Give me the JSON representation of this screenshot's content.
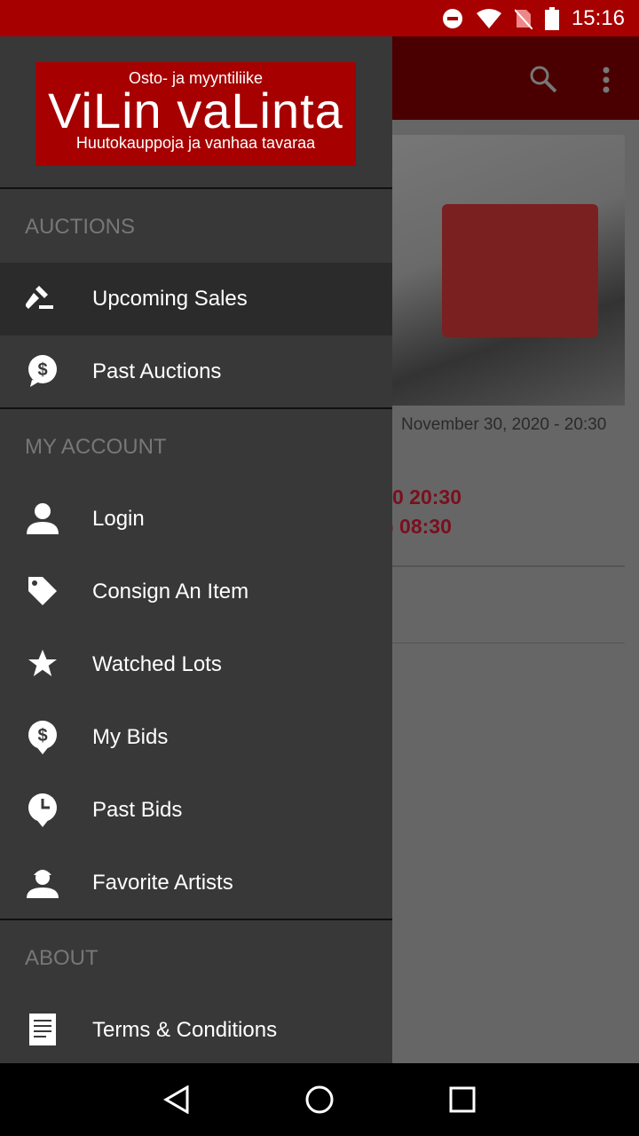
{
  "status_bar": {
    "time": "15:16"
  },
  "logo": {
    "line1": "Osto- ja myyntiliike",
    "line2": "ViLin vaLinta",
    "line3": "Huutokauppoja ja vanhaa tavaraa"
  },
  "background": {
    "date": "November 30, 2020 - 20:30",
    "time1": "0  20:30",
    "time2": ") 08:30"
  },
  "drawer": {
    "sections": [
      {
        "title": "AUCTIONS",
        "items": [
          {
            "label": "Upcoming Sales",
            "icon": "gavel-icon",
            "selected": true
          },
          {
            "label": "Past Auctions",
            "icon": "dollar-bubble-icon"
          }
        ]
      },
      {
        "title": "MY ACCOUNT",
        "items": [
          {
            "label": "Login",
            "icon": "person-icon"
          },
          {
            "label": "Consign An Item",
            "icon": "tag-icon"
          },
          {
            "label": "Watched Lots",
            "icon": "star-icon"
          },
          {
            "label": "My Bids",
            "icon": "dollar-pin-icon"
          },
          {
            "label": "Past Bids",
            "icon": "clock-pin-icon"
          },
          {
            "label": "Favorite Artists",
            "icon": "artist-icon"
          }
        ]
      },
      {
        "title": "ABOUT",
        "items": [
          {
            "label": "Terms & Conditions",
            "icon": "document-icon"
          }
        ]
      }
    ]
  },
  "colors": {
    "status": "#a60000",
    "drawer": "#383838",
    "accent": "#7a0f1e"
  }
}
